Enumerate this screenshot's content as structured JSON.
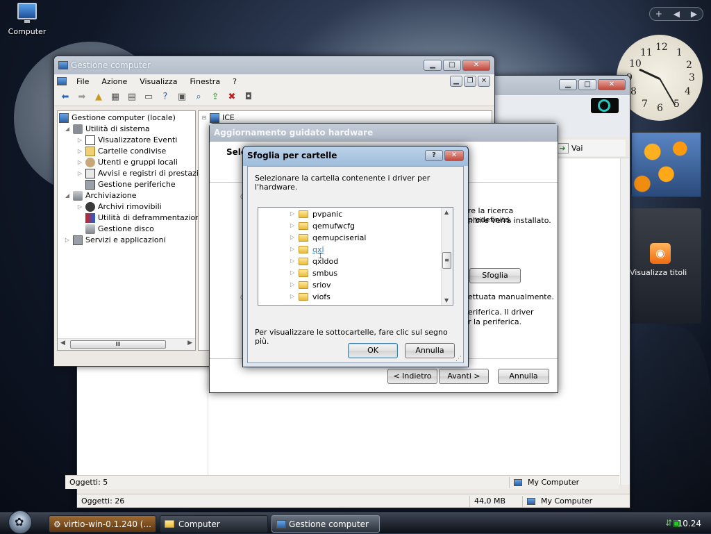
{
  "desktop": {
    "icon_label": "Computer"
  },
  "back_window": {
    "status": {
      "objects": "Oggetti: 26",
      "size": "44,0 MB",
      "location": "My Computer"
    },
    "address_go": "Vai"
  },
  "mgmt_window": {
    "title": "Gestione computer",
    "menu": [
      "File",
      "Azione",
      "Visualizza",
      "Finestra",
      "?"
    ],
    "tree": [
      {
        "label": "Gestione computer (locale)",
        "level": 0
      },
      {
        "label": "Utilità di sistema",
        "level": 1
      },
      {
        "label": "Visualizzatore Eventi",
        "level": 2
      },
      {
        "label": "Cartelle condivise",
        "level": 2
      },
      {
        "label": "Utenti e gruppi locali",
        "level": 2
      },
      {
        "label": "Avvisi e registri di prestazioni",
        "level": 2
      },
      {
        "label": "Gestione periferiche",
        "level": 2
      },
      {
        "label": "Archiviazione",
        "level": 1
      },
      {
        "label": "Archivi rimovibili",
        "level": 2
      },
      {
        "label": "Utilità di deframmentazione dischi",
        "level": 2
      },
      {
        "label": "Gestione disco",
        "level": 2
      },
      {
        "label": "Servizi e applicazioni",
        "level": 1
      }
    ],
    "right_root": "ICE",
    "hscroll_label": "III",
    "status": {
      "objects": "Oggetti: 5",
      "location": "My Computer"
    }
  },
  "wizard": {
    "title": "Aggiornamento guidato hardware",
    "heading": "Sele",
    "text_1a": "re la ricerca predefinita.",
    "text_1b": "nibile verrà installato.",
    "text_2": "ettuata manualmente.",
    "text_3a": "eriferica. Il driver",
    "text_3b": "r la periferica.",
    "browse_button": "Sfoglia",
    "back_button": "< Indietro",
    "next_button": "Avanti >",
    "cancel_button": "Annulla"
  },
  "browse_dialog": {
    "title": "Sfoglia per cartelle",
    "help": "?",
    "instruction": "Selezionare la cartella contenente i driver per l'hardware.",
    "folders": [
      "pvpanic",
      "qemufwcfg",
      "qemupciserial",
      "qxl",
      "qxldod",
      "smbus",
      "sriov",
      "viofs"
    ],
    "hint": "Per visualizzare le sottocartelle, fare clic sul segno più.",
    "ok": "OK",
    "cancel": "Annulla"
  },
  "gadgets": {
    "clock_numbers": [
      "12",
      "1",
      "2",
      "3",
      "4",
      "5",
      "6",
      "7",
      "8",
      "9",
      "10",
      "11"
    ],
    "feeds_label": "Visualizza titoli"
  },
  "taskbar": {
    "tasks": [
      "virtio-win-0.1.240 (...",
      "Computer",
      "Gestione computer"
    ],
    "time": "10.24"
  }
}
